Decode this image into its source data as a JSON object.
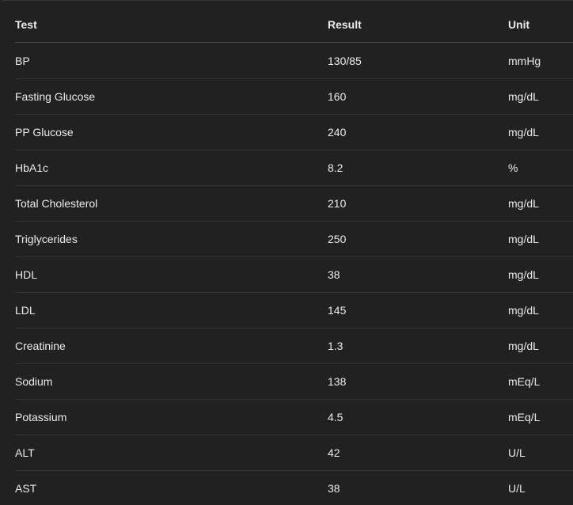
{
  "table": {
    "headers": {
      "test": "Test",
      "result": "Result",
      "unit": "Unit"
    },
    "rows": [
      {
        "test": "BP",
        "result": "130/85",
        "unit": "mmHg"
      },
      {
        "test": "Fasting Glucose",
        "result": "160",
        "unit": "mg/dL"
      },
      {
        "test": "PP Glucose",
        "result": "240",
        "unit": "mg/dL"
      },
      {
        "test": "HbA1c",
        "result": "8.2",
        "unit": "%"
      },
      {
        "test": "Total Cholesterol",
        "result": "210",
        "unit": "mg/dL"
      },
      {
        "test": "Triglycerides",
        "result": "250",
        "unit": "mg/dL"
      },
      {
        "test": "HDL",
        "result": "38",
        "unit": "mg/dL"
      },
      {
        "test": "LDL",
        "result": "145",
        "unit": "mg/dL"
      },
      {
        "test": "Creatinine",
        "result": "1.3",
        "unit": "mg/dL"
      },
      {
        "test": "Sodium",
        "result": "138",
        "unit": "mEq/L"
      },
      {
        "test": "Potassium",
        "result": "4.5",
        "unit": "mEq/L"
      },
      {
        "test": "ALT",
        "result": "42",
        "unit": "U/L"
      },
      {
        "test": "AST",
        "result": "38",
        "unit": "U/L"
      }
    ]
  },
  "colors": {
    "background": "#212121",
    "text": "#ececec",
    "divider": "#343434"
  }
}
